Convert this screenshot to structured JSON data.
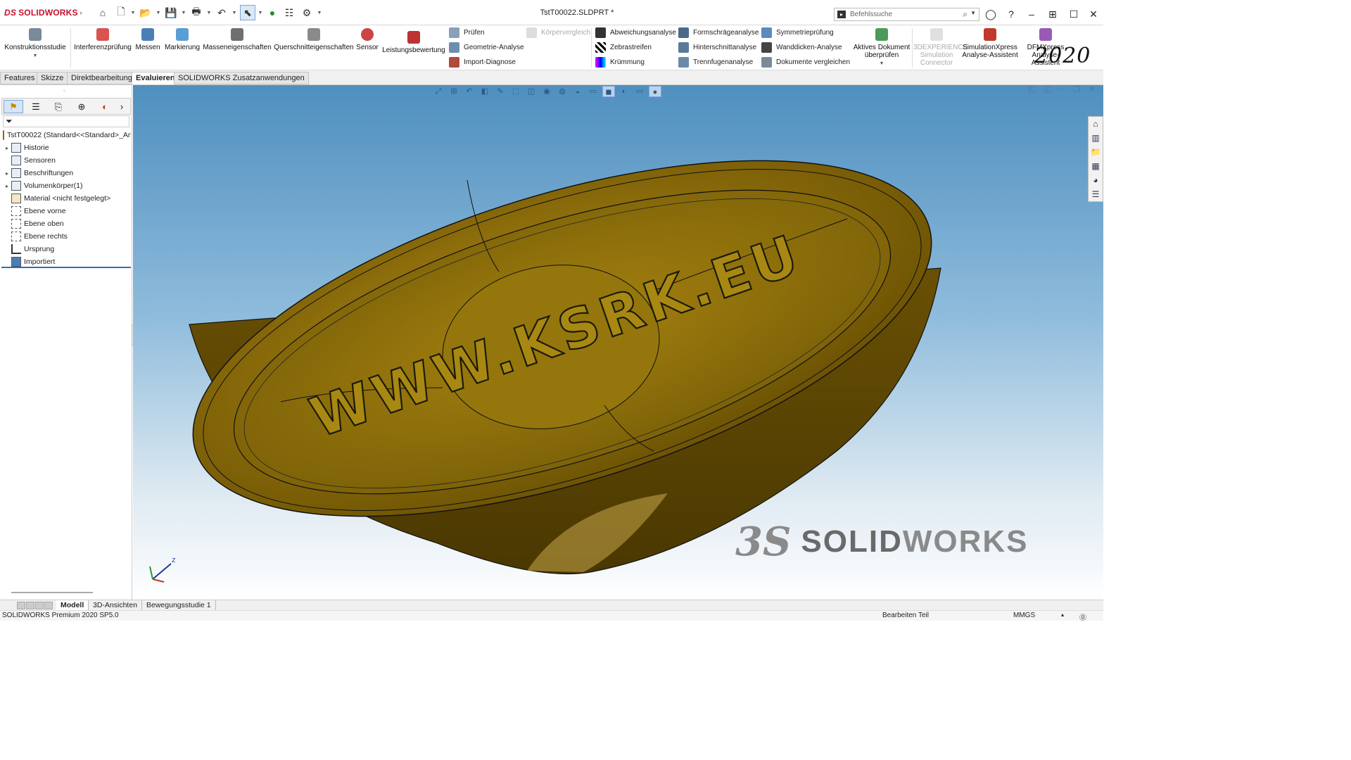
{
  "app": {
    "brand": "SOLIDWORKS",
    "year": "2020",
    "window_title": "TstT00022.SLDPRT *"
  },
  "search": {
    "placeholder": "Befehlssuche"
  },
  "ribbon": {
    "buttons": [
      {
        "label": "Konstruktionsstudie"
      },
      {
        "label": "Interferenzprüfung"
      },
      {
        "label": "Messen"
      },
      {
        "label": "Markierung"
      },
      {
        "label": "Masseneigenschaften"
      },
      {
        "label": "Querschnitteigenschaften"
      },
      {
        "label": "Sensor"
      },
      {
        "label": "Leistungsbewertung"
      }
    ],
    "col1": [
      "Prüfen",
      "Geometrie-Analyse",
      "Import-Diagnose"
    ],
    "col1_disabled": "Körpervergleich",
    "col2": [
      "Abweichungsanalyse",
      "Zebrastreifen",
      "Krümmung"
    ],
    "col3": [
      "Formschrägeanalyse",
      "Hinterschnittanalyse",
      "Trennfugenanalyse"
    ],
    "col4": [
      "Symmetrieprüfung",
      "Wanddicken-Analyse",
      "Dokumente vergleichen"
    ],
    "active_doc": "Aktives Dokument überprüfen",
    "connector": "3DEXPERIENCE Simulation Connector",
    "simxpress": "SimulationXpress Analyse-Assistent",
    "dfmxpress": "DFMXpress Analyse-Assistent"
  },
  "tabs": [
    "Features",
    "Skizze",
    "Direktbearbeitung",
    "Evaluieren",
    "SOLIDWORKS Zusatzanwendungen"
  ],
  "active_tab": "Evaluieren",
  "tree": {
    "root": "TstT00022  (Standard<<Standard>_An",
    "items": [
      {
        "label": "Historie",
        "expandable": true
      },
      {
        "label": "Sensoren",
        "expandable": false
      },
      {
        "label": "Beschriftungen",
        "expandable": true
      },
      {
        "label": "Volumenkörper(1)",
        "expandable": true
      },
      {
        "label": "Material <nicht festgelegt>",
        "expandable": false
      },
      {
        "label": "Ebene vorne",
        "expandable": false
      },
      {
        "label": "Ebene oben",
        "expandable": false
      },
      {
        "label": "Ebene rechts",
        "expandable": false
      },
      {
        "label": "Ursprung",
        "expandable": false
      },
      {
        "label": "Importiert",
        "expandable": false
      }
    ]
  },
  "model": {
    "engraving": "WWW.KSRK.EU",
    "color": "#8a6b08"
  },
  "watermark": {
    "mark": "3S",
    "solid": "SOLID",
    "works": "WORKS"
  },
  "bottom_tabs": [
    "Modell",
    "3D-Ansichten",
    "Bewegungsstudie 1"
  ],
  "status": {
    "version": "SOLIDWORKS Premium 2020 SP5.0",
    "mode": "Bearbeiten Teil",
    "units": "MMGS"
  }
}
